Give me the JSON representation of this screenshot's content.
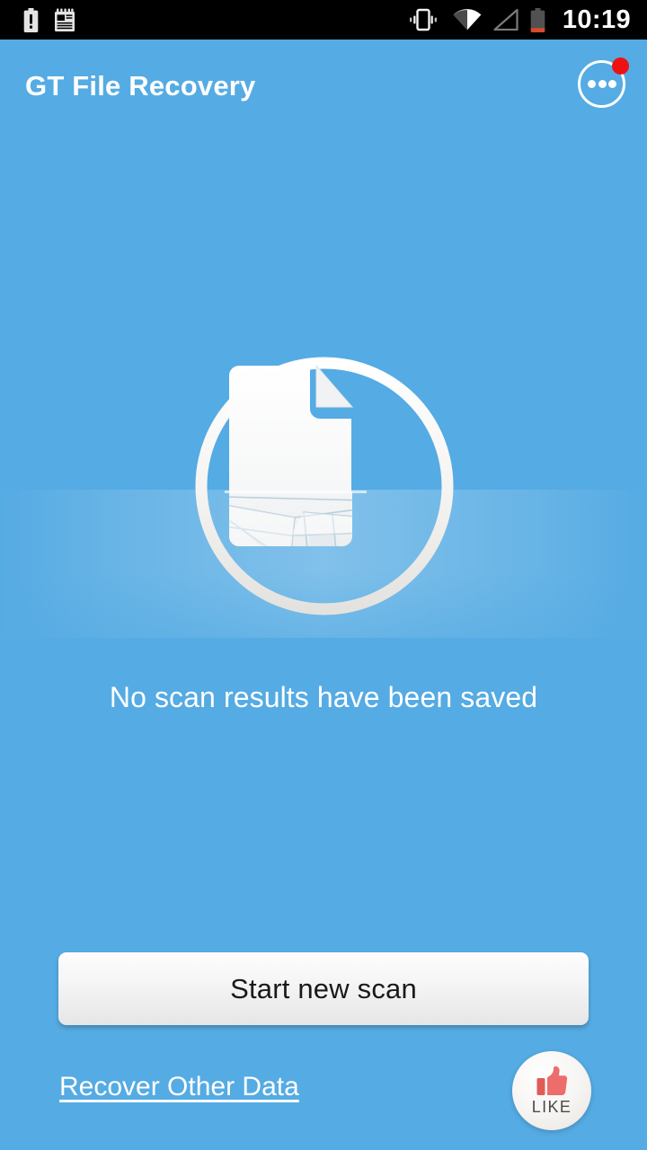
{
  "status_bar": {
    "clock": "10:19",
    "left_icons": [
      {
        "name": "battery-alert-icon",
        "label": "battery-alert"
      },
      {
        "name": "notepad-icon",
        "label": "notepad"
      }
    ],
    "right_icons": [
      {
        "name": "vibrate-icon",
        "label": "vibrate"
      },
      {
        "name": "wifi-icon",
        "label": "wifi-full"
      },
      {
        "name": "cell-signal-icon",
        "label": "cell-signal-empty"
      },
      {
        "name": "battery-icon",
        "label": "battery-low"
      }
    ]
  },
  "action_bar": {
    "title": "GT File Recovery",
    "overflow_menu": {
      "name": "overflow-menu-button",
      "has_badge": true,
      "badge_color": "#ef1111"
    }
  },
  "main": {
    "illustration": {
      "name": "broken-document-illustration",
      "description": "white circle ring containing a document with a folded corner, lower half shattered"
    },
    "empty_state_text": "No scan results have been saved"
  },
  "actions": {
    "start_scan_label": "Start new scan",
    "recover_other_data_label": "Recover Other Data",
    "like_label": "LIKE"
  },
  "colors": {
    "background_blue": "#55abe3",
    "status_bar": "#000000",
    "title_text": "#ffffff",
    "button_text": "#1a1a1a",
    "badge_red": "#ef1111",
    "thumb_red": "#ec6d6a",
    "like_label_gray": "#4a4a4a"
  }
}
